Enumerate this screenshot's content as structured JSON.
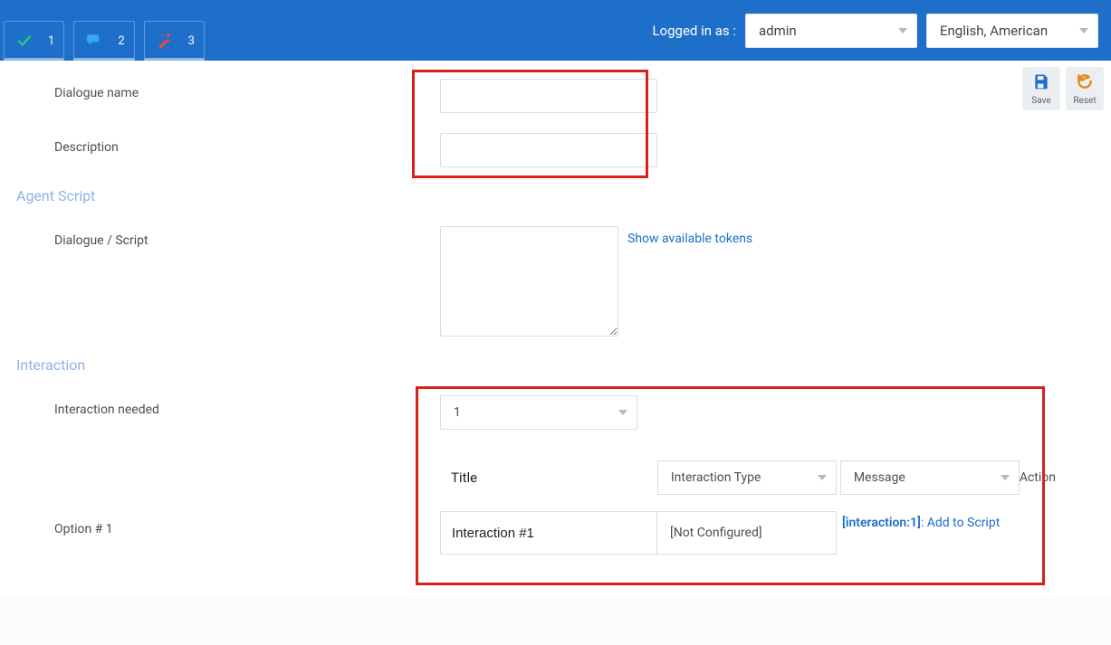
{
  "header": {
    "tabs": [
      {
        "icon": "check",
        "num": "1"
      },
      {
        "icon": "chat",
        "num": "2"
      },
      {
        "icon": "magic",
        "num": "3"
      }
    ],
    "logged_in_label": "Logged in as :",
    "user": "admin",
    "language": "English, American"
  },
  "actions": {
    "save": "Save",
    "reset": "Reset"
  },
  "fields": {
    "dialogue_name_label": "Dialogue name",
    "dialogue_name_value": "",
    "description_label": "Description",
    "description_value": ""
  },
  "sections": {
    "agent_script": "Agent Script",
    "dialogue_script_label": "Dialogue / Script",
    "dialogue_script_value": "",
    "show_tokens": "Show available tokens",
    "interaction": "Interaction",
    "interaction_needed_label": "Interaction needed",
    "interaction_needed_value": "1"
  },
  "interaction_table": {
    "header_title": "Title",
    "header_type_placeholder": "Interaction Type",
    "header_msg_placeholder": "Message",
    "header_action": "Action",
    "option_label": "Option # 1",
    "option_title_value": "Interaction #1",
    "option_type_value": "[Not Configured]",
    "action_token": "[interaction:1]",
    "action_text": ": Add to Script"
  }
}
